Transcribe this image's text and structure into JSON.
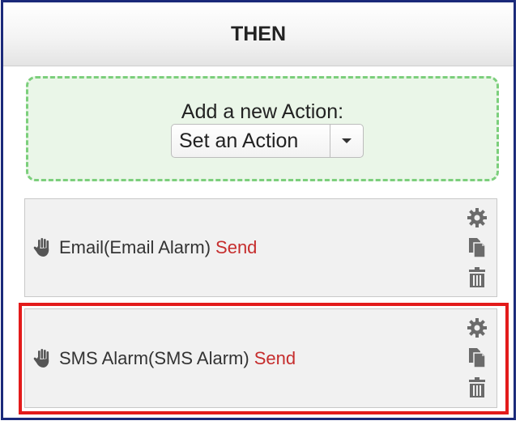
{
  "panel": {
    "title": "THEN"
  },
  "new_action": {
    "label": "Add a new Action:",
    "select_value": "Set an Action"
  },
  "actions": [
    {
      "name": "Email(Email Alarm)",
      "verb": "Send",
      "icons": [
        "grip-icon",
        "gear-icon",
        "copy-icon",
        "trash-icon"
      ]
    },
    {
      "name": "SMS Alarm(SMS Alarm)",
      "verb": "Send",
      "highlighted": true,
      "icons": [
        "grip-icon",
        "gear-icon",
        "copy-icon",
        "trash-icon"
      ]
    }
  ],
  "colors": {
    "frame": "#1b2a7a",
    "dropzone_border": "#7ccf7c",
    "send": "#c62d2d",
    "highlight": "#e31b1b"
  }
}
